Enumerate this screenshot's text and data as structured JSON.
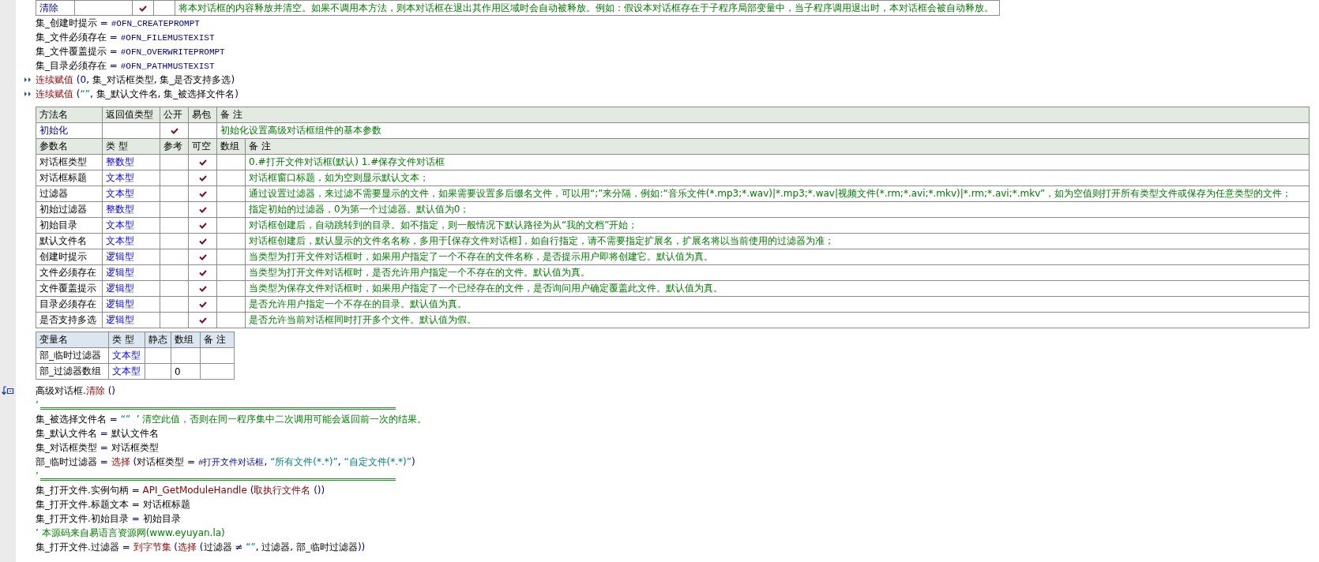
{
  "top_row": {
    "name": "清除",
    "public": true,
    "easy_pack": false,
    "note": "将本对话框的内容释放并清空。如果不调用本方法，则本对话框在退出其作用区域时会自动被释放。例如：假设本对话框存在于子程序局部变量中，当子程序调用退出时，本对话框会被自动释放。"
  },
  "code_top": [
    {
      "kind": "code",
      "segments": [
        {
          "kind": "text",
          "text": "集_创建时提示"
        },
        {
          "kind": "operator",
          "text": " = "
        },
        {
          "kind": "constant",
          "text": "#OFN_CREATEPROMPT"
        }
      ]
    },
    {
      "kind": "code",
      "segments": [
        {
          "kind": "text",
          "text": "集_文件必须存在"
        },
        {
          "kind": "operator",
          "text": " = "
        },
        {
          "kind": "constant",
          "text": "#OFN_FILEMUSTEXIST"
        }
      ]
    },
    {
      "kind": "code",
      "segments": [
        {
          "kind": "text",
          "text": "集_文件覆盖提示"
        },
        {
          "kind": "operator",
          "text": " = "
        },
        {
          "kind": "constant",
          "text": "#OFN_OVERWRITEPROMPT"
        }
      ]
    },
    {
      "kind": "code",
      "segments": [
        {
          "kind": "text",
          "text": "集_目录必须存在"
        },
        {
          "kind": "operator",
          "text": " = "
        },
        {
          "kind": "constant",
          "text": "#OFN_PATHMUSTEXIST"
        }
      ]
    },
    {
      "kind": "code",
      "arrow_marker": true,
      "segments": [
        {
          "kind": "function",
          "text": "连续赋值"
        },
        {
          "kind": "operator",
          "text": " ("
        },
        {
          "kind": "number",
          "text": "0"
        },
        {
          "kind": "text",
          "text": ", 集_对话框类型, 集_是否支持多选"
        },
        {
          "kind": "operator",
          "text": ")"
        }
      ]
    },
    {
      "kind": "code",
      "arrow_marker": true,
      "segments": [
        {
          "kind": "function",
          "text": "连续赋值"
        },
        {
          "kind": "operator",
          "text": " ("
        },
        {
          "kind": "string",
          "text": "“”"
        },
        {
          "kind": "text",
          "text": ", 集_默认文件名, 集_被选择文件名"
        },
        {
          "kind": "operator",
          "text": ")"
        }
      ]
    }
  ],
  "method_table": {
    "columns": [
      "方法名",
      "返回值类型",
      "公开",
      "易包",
      "备 注"
    ],
    "rows": [
      {
        "name": "初始化",
        "public": true,
        "easy_pack": false,
        "note": "初始化设置高级对话框组件的基本参数"
      }
    ]
  },
  "param_table": {
    "columns": [
      "参数名",
      "类 型",
      "参考",
      "可空",
      "数组",
      "备 注"
    ],
    "rows": [
      {
        "name": "对话框类型",
        "type": "整数型",
        "reference": false,
        "nullable": true,
        "array": false,
        "note": "0.#打开文件对话框(默认)  1.#保存文件对话框"
      },
      {
        "name": "对话框标题",
        "type": "文本型",
        "reference": false,
        "nullable": true,
        "array": false,
        "note": "对话框窗口标题，如为空则显示默认文本；"
      },
      {
        "name": "过滤器",
        "type": "文本型",
        "reference": false,
        "nullable": true,
        "array": false,
        "note": "通过设置过滤器，来过滤不需要显示的文件，如果需要设置多后缀名文件，可以用“;”来分隔，例如:“音乐文件(*.mp3;*.wav)|*.mp3;*.wav|视频文件(*.rm;*.avi;*.mkv)|*.rm;*.avi;*.mkv”，如为空值则打开所有类型文件或保存为任意类型的文件；"
      },
      {
        "name": "初始过滤器",
        "type": "整数型",
        "reference": false,
        "nullable": true,
        "array": false,
        "note": "指定初始的过滤器，0为第一个过滤器。默认值为0；"
      },
      {
        "name": "初始目录",
        "type": "文本型",
        "reference": false,
        "nullable": true,
        "array": false,
        "note": "对话框创建后，自动跳转到的目录。如不指定，则一般情况下默认路径为从“我的文档”开始；"
      },
      {
        "name": "默认文件名",
        "type": "文本型",
        "reference": false,
        "nullable": true,
        "array": false,
        "note": "对话框创建后，默认显示的文件名名称，多用于[保存文件对话框]，如自行指定，请不需要指定扩展名，扩展名将以当前使用的过滤器为准；"
      },
      {
        "name": "创建时提示",
        "type": "逻辑型",
        "reference": false,
        "nullable": true,
        "array": false,
        "note": "当类型为打开文件对话框时，如果用户指定了一个不存在的文件名称，是否提示用户即将创建它。默认值为真。"
      },
      {
        "name": "文件必须存在",
        "type": "逻辑型",
        "reference": false,
        "nullable": true,
        "array": false,
        "note": "当类型为打开文件对话框时，是否允许用户指定一个不存在的文件。默认值为真。"
      },
      {
        "name": "文件覆盖提示",
        "type": "逻辑型",
        "reference": false,
        "nullable": true,
        "array": false,
        "note": "当类型为保存文件对话框时，如果用户指定了一个已经存在的文件，是否询问用户确定覆盖此文件。默认值为真。"
      },
      {
        "name": "目录必须存在",
        "type": "逻辑型",
        "reference": false,
        "nullable": true,
        "array": false,
        "note": "是否允许用户指定一个不存在的目录。默认值为真。"
      },
      {
        "name": "是否支持多选",
        "type": "逻辑型",
        "reference": false,
        "nullable": true,
        "array": false,
        "note": "是否允许当前对话框同时打开多个文件。默认值为假。"
      }
    ]
  },
  "var_table": {
    "columns": [
      "变量名",
      "类 型",
      "静态",
      "数组",
      "备 注"
    ],
    "rows": [
      {
        "name": "部_临时过滤器",
        "type": "文本型",
        "static": false
      },
      {
        "name": "部_过滤器数组",
        "type": "文本型",
        "static": false,
        "array": "0"
      }
    ]
  },
  "code_bottom": [
    {
      "kind": "code",
      "step_marker": true,
      "segments": [
        {
          "kind": "text",
          "text": "高级对话框."
        },
        {
          "kind": "function",
          "text": "清除"
        },
        {
          "kind": "operator",
          "text": " ()"
        }
      ]
    },
    {
      "kind": "separator",
      "segments": [
        {
          "kind": "comment",
          "text": "’"
        }
      ]
    },
    {
      "kind": "code",
      "segments": [
        {
          "kind": "text",
          "text": "集_被选择文件名"
        },
        {
          "kind": "operator",
          "text": " = "
        },
        {
          "kind": "string",
          "text": "“”"
        },
        {
          "kind": "comment",
          "text": "  ’ 清空此值，否则在同一程序集中二次调用可能会返回前一次的结果。"
        }
      ]
    },
    {
      "kind": "code",
      "segments": [
        {
          "kind": "text",
          "text": "集_默认文件名"
        },
        {
          "kind": "operator",
          "text": " = "
        },
        {
          "kind": "text",
          "text": "默认文件名"
        }
      ]
    },
    {
      "kind": "code",
      "segments": [
        {
          "kind": "text",
          "text": "集_对话框类型"
        },
        {
          "kind": "operator",
          "text": " = "
        },
        {
          "kind": "text",
          "text": "对话框类型"
        }
      ]
    },
    {
      "kind": "code",
      "segments": [
        {
          "kind": "text",
          "text": "部_临时过滤器"
        },
        {
          "kind": "operator",
          "text": " = "
        },
        {
          "kind": "function",
          "text": "选择"
        },
        {
          "kind": "operator",
          "text": " ("
        },
        {
          "kind": "text",
          "text": "对话框类型"
        },
        {
          "kind": "operator",
          "text": " = "
        },
        {
          "kind": "constant",
          "text": "#打开文件对话框"
        },
        {
          "kind": "text",
          "text": ", "
        },
        {
          "kind": "string",
          "text": "“所有文件(*.*)”"
        },
        {
          "kind": "text",
          "text": ", "
        },
        {
          "kind": "string",
          "text": "“自定文件(*.*)”"
        },
        {
          "kind": "operator",
          "text": ")"
        }
      ]
    },
    {
      "kind": "separator",
      "segments": [
        {
          "kind": "comment",
          "text": "’"
        }
      ]
    },
    {
      "kind": "code",
      "segments": [
        {
          "kind": "text",
          "text": "集_打开文件.实例句柄"
        },
        {
          "kind": "operator",
          "text": " = "
        },
        {
          "kind": "function",
          "text": "API_GetModuleHandle"
        },
        {
          "kind": "operator",
          "text": " ("
        },
        {
          "kind": "function",
          "text": "取执行文件名"
        },
        {
          "kind": "operator",
          "text": " ())"
        }
      ]
    },
    {
      "kind": "code",
      "segments": [
        {
          "kind": "text",
          "text": "集_打开文件.标题文本"
        },
        {
          "kind": "operator",
          "text": " = "
        },
        {
          "kind": "text",
          "text": "对话框标题"
        }
      ]
    },
    {
      "kind": "code",
      "segments": [
        {
          "kind": "text",
          "text": "集_打开文件.初始目录"
        },
        {
          "kind": "operator",
          "text": " = "
        },
        {
          "kind": "text",
          "text": "初始目录"
        }
      ]
    },
    {
      "kind": "code",
      "segments": [
        {
          "kind": "comment",
          "text": "’ 本源码来自易语言资源网(www.eyuyan.la)"
        }
      ]
    },
    {
      "kind": "code",
      "segments": [
        {
          "kind": "text",
          "text": "集_打开文件.过滤器"
        },
        {
          "kind": "operator",
          "text": " = "
        },
        {
          "kind": "function",
          "text": "到字节集"
        },
        {
          "kind": "operator",
          "text": " ("
        },
        {
          "kind": "function",
          "text": "选择"
        },
        {
          "kind": "operator",
          "text": " ("
        },
        {
          "kind": "text",
          "text": "过滤器"
        },
        {
          "kind": "operator",
          "text": " ≠ "
        },
        {
          "kind": "string",
          "text": "“”"
        },
        {
          "kind": "text",
          "text": ", 过滤器, 部_临时过滤器"
        },
        {
          "kind": "operator",
          "text": "))"
        }
      ]
    }
  ]
}
